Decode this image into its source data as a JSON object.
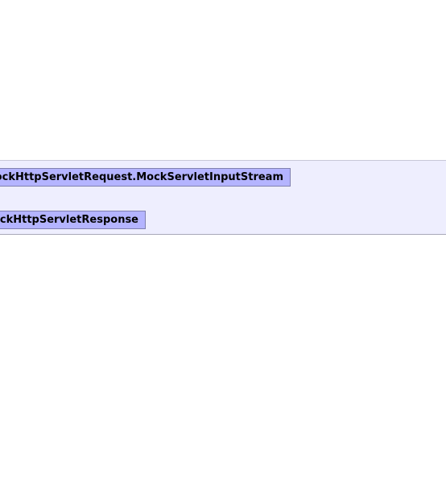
{
  "diagram": {
    "classes": [
      {
        "label": "MockHttpServletRequest.MockServletInputStream"
      },
      {
        "label": "MockHttpServletResponse"
      }
    ]
  },
  "colors": {
    "panel_background": "#eeeefe",
    "class_box_fill": "#b4b4ff",
    "class_box_border": "#8080b0"
  }
}
